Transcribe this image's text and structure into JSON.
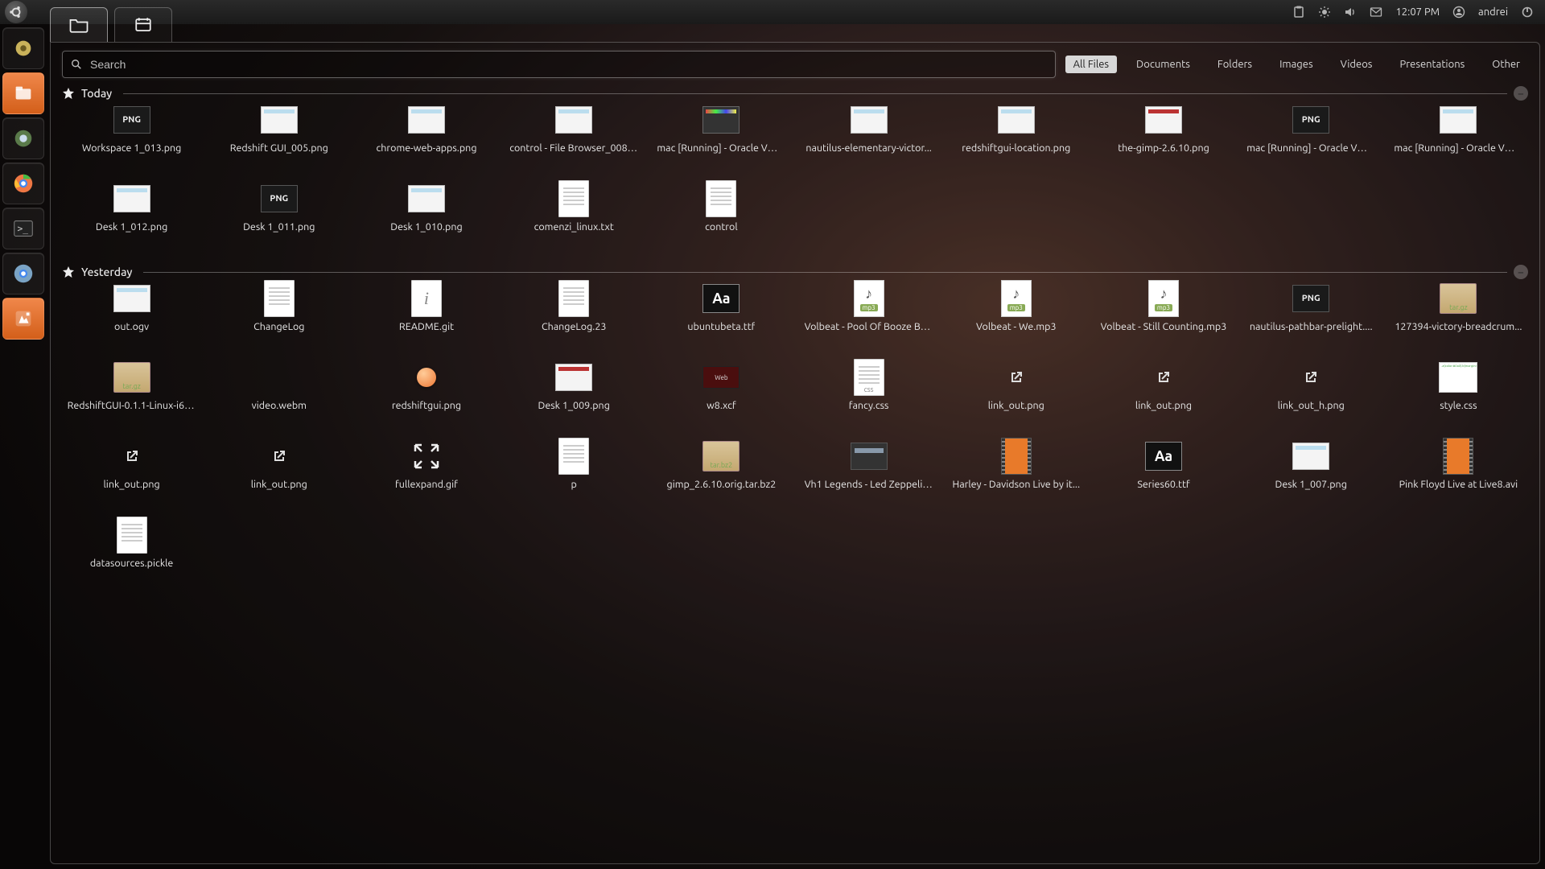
{
  "panel": {
    "clock": "12:07 PM",
    "user": "andrei"
  },
  "search": {
    "placeholder": "Search"
  },
  "filters": [
    {
      "key": "all",
      "label": "All Files",
      "active": true
    },
    {
      "key": "documents",
      "label": "Documents",
      "active": false
    },
    {
      "key": "folders",
      "label": "Folders",
      "active": false
    },
    {
      "key": "images",
      "label": "Images",
      "active": false
    },
    {
      "key": "videos",
      "label": "Videos",
      "active": false
    },
    {
      "key": "presentations",
      "label": "Presentations",
      "active": false
    },
    {
      "key": "other",
      "label": "Other",
      "active": false
    }
  ],
  "sections": {
    "today": {
      "title": "Today",
      "items": [
        {
          "label": "Workspace 1_013.png",
          "kind": "png-dark"
        },
        {
          "label": "Redshift GUI_005.png",
          "kind": "screenshot"
        },
        {
          "label": "chrome-web-apps.png",
          "kind": "screenshot"
        },
        {
          "label": "control - File Browser_008.p...",
          "kind": "screenshot"
        },
        {
          "label": "mac [Running] - Oracle VM ...",
          "kind": "colorful"
        },
        {
          "label": "nautilus-elementary-victor...",
          "kind": "screenshot"
        },
        {
          "label": "redshiftgui-location.png",
          "kind": "screenshot"
        },
        {
          "label": "the-gimp-2.6.10.png",
          "kind": "screenshot-red"
        },
        {
          "label": "mac [Running] - Oracle VM ...",
          "kind": "png-dark"
        },
        {
          "label": "mac [Running] - Oracle VM ...",
          "kind": "screenshot"
        },
        {
          "label": "Desk 1_012.png",
          "kind": "screenshot"
        },
        {
          "label": "Desk 1_011.png",
          "kind": "png-dark"
        },
        {
          "label": "Desk 1_010.png",
          "kind": "screenshot"
        },
        {
          "label": "comenzi_linux.txt",
          "kind": "doc"
        },
        {
          "label": "control",
          "kind": "doc"
        }
      ]
    },
    "yesterday": {
      "title": "Yesterday",
      "items": [
        {
          "label": "out.ogv",
          "kind": "screenshot"
        },
        {
          "label": "ChangeLog",
          "kind": "doc"
        },
        {
          "label": "README.git",
          "kind": "info"
        },
        {
          "label": "ChangeLog.23",
          "kind": "doc"
        },
        {
          "label": "ubuntubeta.ttf",
          "kind": "font"
        },
        {
          "label": "Volbeat - Pool Of Booze Bo...",
          "kind": "audio"
        },
        {
          "label": "Volbeat - We.mp3",
          "kind": "audio"
        },
        {
          "label": "Volbeat - Still Counting.mp3",
          "kind": "audio"
        },
        {
          "label": "nautilus-pathbar-prelight....",
          "kind": "png-dark"
        },
        {
          "label": "127394-victory-breadcrum...",
          "kind": "archive-targz"
        },
        {
          "label": "RedshiftGUI-0.1.1-Linux-i68...",
          "kind": "archive-targz"
        },
        {
          "label": "video.webm",
          "kind": "blank"
        },
        {
          "label": "redshiftgui.png",
          "kind": "orb"
        },
        {
          "label": "Desk 1_009.png",
          "kind": "screenshot-red"
        },
        {
          "label": "w8.xcf",
          "kind": "darkred"
        },
        {
          "label": "fancy.css",
          "kind": "css"
        },
        {
          "label": "link_out.png",
          "kind": "link"
        },
        {
          "label": "link_out.png",
          "kind": "link"
        },
        {
          "label": "link_out_h.png",
          "kind": "link"
        },
        {
          "label": "style.css",
          "kind": "codethumb"
        },
        {
          "label": "link_out.png",
          "kind": "link"
        },
        {
          "label": "link_out.png",
          "kind": "link"
        },
        {
          "label": "fullexpand.gif",
          "kind": "expand"
        },
        {
          "label": "p",
          "kind": "doc"
        },
        {
          "label": "gimp_2.6.10.orig.tar.bz2",
          "kind": "archive-tarbz2"
        },
        {
          "label": "Vh1 Legends - Led Zeppelin...",
          "kind": "thumb-img"
        },
        {
          "label": "Harley - Davidson Live by it...",
          "kind": "video"
        },
        {
          "label": "Series60.ttf",
          "kind": "font"
        },
        {
          "label": "Desk 1_007.png",
          "kind": "screenshot"
        },
        {
          "label": "Pink Floyd Live at Live8.avi",
          "kind": "video"
        },
        {
          "label": "datasources.pickle",
          "kind": "doc"
        }
      ]
    }
  }
}
